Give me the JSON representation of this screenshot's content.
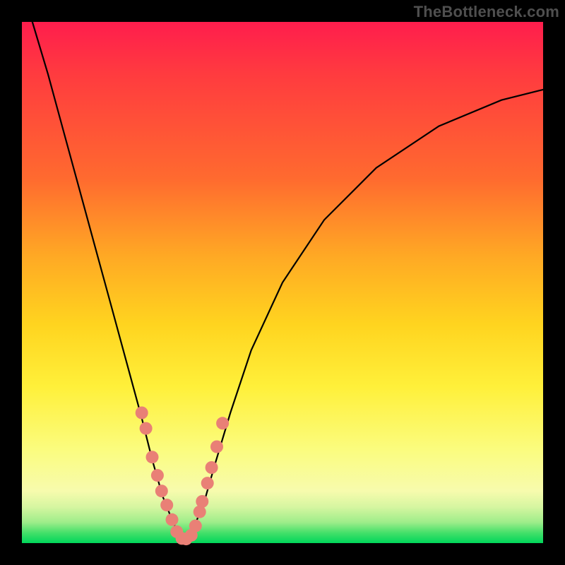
{
  "watermark": "TheBottleneck.com",
  "colors": {
    "frame": "#000000",
    "curve": "#000000",
    "marker_fill": "#e98076",
    "marker_stroke": "#d46a60"
  },
  "chart_data": {
    "type": "line",
    "title": "",
    "xlabel": "",
    "ylabel": "",
    "xlim": [
      0,
      100
    ],
    "ylim": [
      0,
      100
    ],
    "grid": false,
    "legend": false,
    "note": "Axes are unlabeled; x is horizontal position (0=left,100=right), y is vertical position (0=bottom,100=top). Values are estimated from pixel positions.",
    "series": [
      {
        "name": "curve",
        "x": [
          2,
          5,
          8,
          11,
          14,
          17,
          20,
          23,
          25,
          27,
          29,
          30.5,
          32,
          33,
          35,
          37,
          40,
          44,
          50,
          58,
          68,
          80,
          92,
          100
        ],
        "y": [
          100,
          90,
          79,
          68,
          57,
          46,
          35,
          24,
          16,
          9,
          4,
          1,
          1,
          3,
          8,
          15,
          25,
          37,
          50,
          62,
          72,
          80,
          85,
          87
        ]
      }
    ],
    "markers": {
      "name": "highlighted-points",
      "note": "Salmon-colored dots clustered near the curve minimum on both branches",
      "x": [
        23.0,
        23.8,
        25.0,
        26.0,
        26.8,
        27.8,
        28.8,
        29.7,
        30.7,
        31.5,
        32.5,
        33.3,
        34.1,
        34.6,
        35.6,
        36.4,
        37.4,
        38.5
      ],
      "y": [
        25.0,
        22.0,
        16.5,
        13.0,
        10.0,
        7.3,
        4.5,
        2.2,
        0.9,
        0.8,
        1.5,
        3.3,
        6.0,
        8.0,
        11.5,
        14.5,
        18.5,
        23.0
      ]
    }
  }
}
